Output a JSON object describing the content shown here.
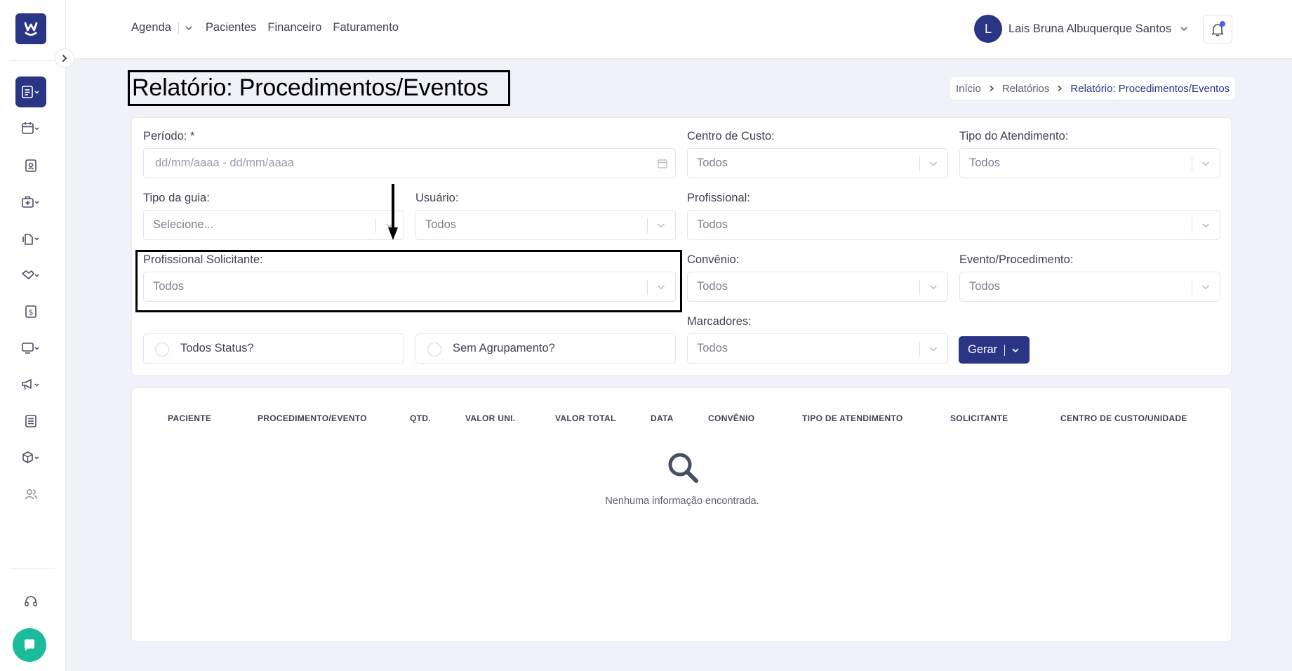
{
  "header": {
    "nav": [
      "Agenda",
      "Pacientes",
      "Financeiro",
      "Faturamento"
    ],
    "user_initial": "L",
    "user_name": "Lais Bruna Albuquerque Santos"
  },
  "sidebar": {
    "icons": [
      "reports-icon",
      "calendar-icon",
      "patient-badge-icon",
      "medical-kit-icon",
      "documents-icon",
      "handshake-icon",
      "dollar-icon",
      "monitor-icon",
      "megaphone-icon",
      "newspaper-icon",
      "box-icon",
      "users-icon",
      "headset-icon",
      "chat-icon"
    ]
  },
  "page": {
    "title": "Relatório: Procedimentos/Eventos",
    "breadcrumb": [
      "Início",
      "Relatórios",
      "Relatório: Procedimentos/Eventos"
    ]
  },
  "filters": {
    "periodo": {
      "label": "Período: *",
      "placeholder": "dd/mm/aaaa - dd/mm/aaaa"
    },
    "centro_custo": {
      "label": "Centro de Custo:",
      "value": "Todos"
    },
    "tipo_atendimento": {
      "label": "Tipo do Atendimento:",
      "value": "Todos"
    },
    "tipo_guia": {
      "label": "Tipo da guia:",
      "value": "Selecione..."
    },
    "usuario": {
      "label": "Usuário:",
      "value": "Todos"
    },
    "profissional": {
      "label": "Profissional:",
      "value": "Todos"
    },
    "profissional_solicitante": {
      "label": "Profissional Solicitante:",
      "value": "Todos"
    },
    "convenio": {
      "label": "Convênio:",
      "value": "Todos"
    },
    "evento_procedimento": {
      "label": "Evento/Procedimento:",
      "value": "Todos"
    },
    "marcadores": {
      "label": "Marcadores:",
      "value": "Todos"
    },
    "todos_status": "Todos Status?",
    "sem_agrupamento": "Sem Agrupamento?",
    "gerar_label": "Gerar"
  },
  "results": {
    "columns": [
      "PACIENTE",
      "PROCEDIMENTO/EVENTO",
      "QTD.",
      "VALOR UNI.",
      "VALOR TOTAL",
      "DATA",
      "CONVÊNIO",
      "TIPO DE ATENDIMENTO",
      "SOLICITANTE",
      "CENTRO DE CUSTO/UNIDADE"
    ],
    "empty_message": "Nenhuma informação encontrada."
  }
}
